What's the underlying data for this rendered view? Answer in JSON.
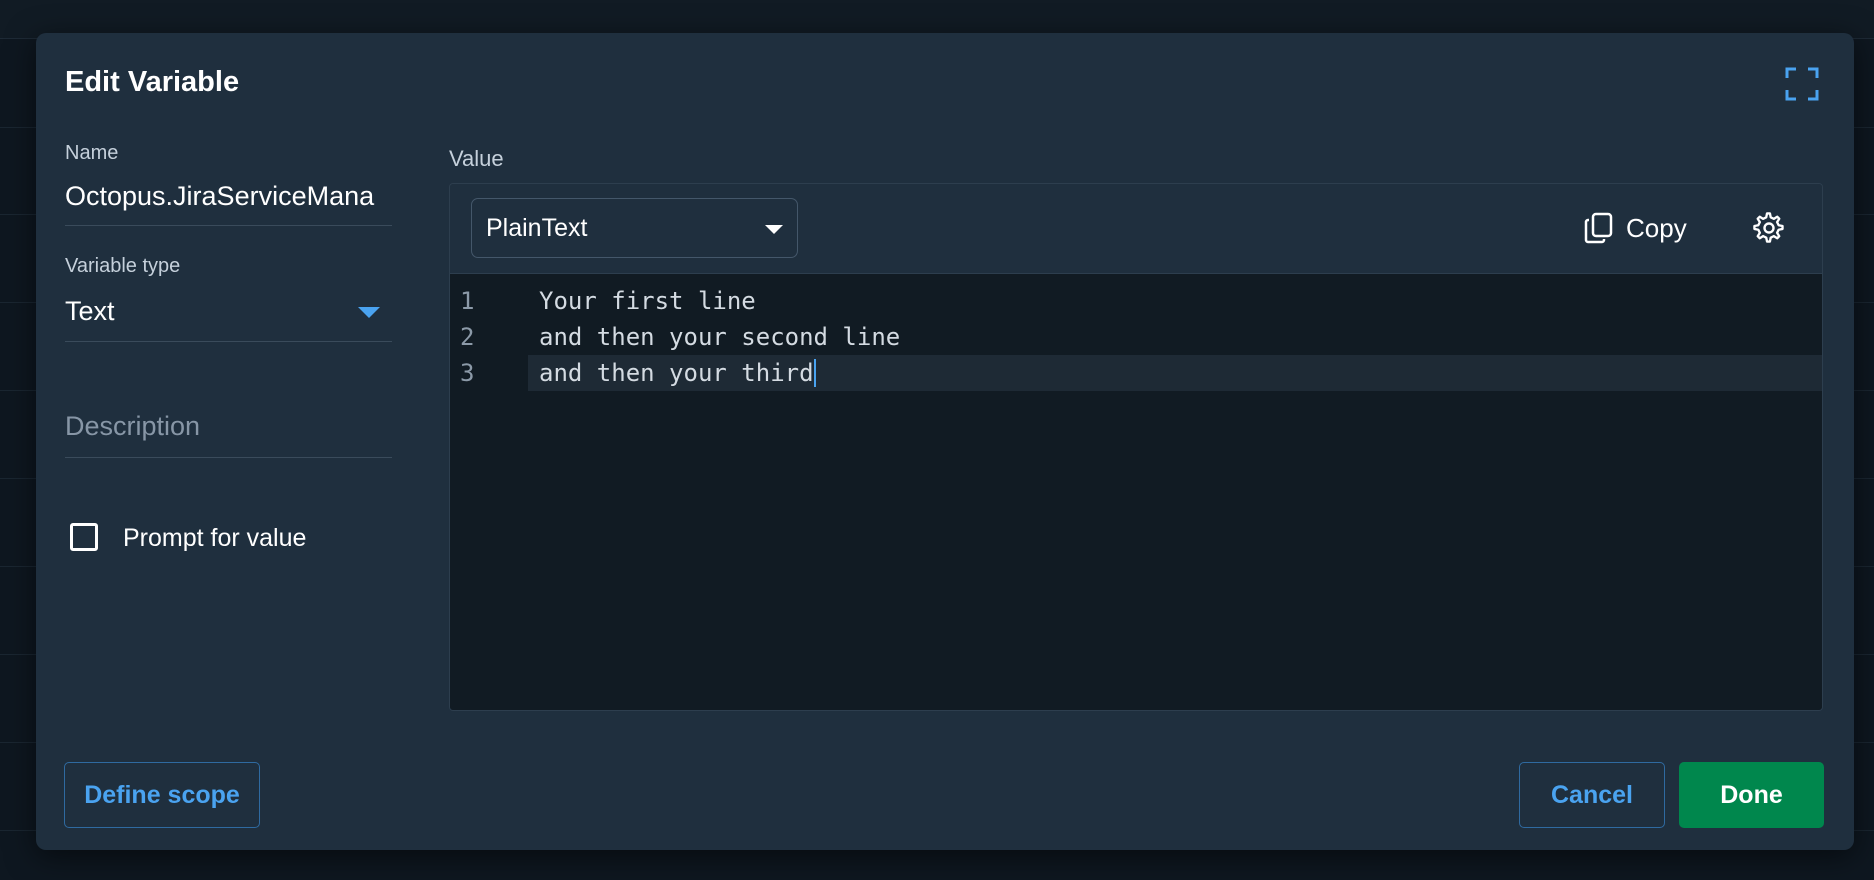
{
  "dialog": {
    "title": "Edit Variable"
  },
  "form": {
    "name_label": "Name",
    "name_value": "Octopus.JiraServiceMana",
    "type_label": "Variable type",
    "type_value": "Text",
    "description_placeholder": "Description",
    "prompt_label": "Prompt for value",
    "prompt_checked": false
  },
  "value": {
    "label": "Value",
    "syntax": "PlainText",
    "copy_label": "Copy",
    "lines": [
      {
        "number": "1",
        "text": "Your first line"
      },
      {
        "number": "2",
        "text": "and then your second line"
      },
      {
        "number": "3",
        "text": "and then your third"
      }
    ],
    "active_line": 3
  },
  "footer": {
    "define_scope_label": "Define scope",
    "cancel_label": "Cancel",
    "done_label": "Done"
  },
  "icons": {
    "fullscreen": "expand-icon",
    "copy": "copy-icon",
    "settings": "gear-icon"
  },
  "colors": {
    "accent": "#4aa3f0",
    "primary_button": "#00874d",
    "dialog_bg": "#1f2f3e",
    "editor_bg": "#111b23"
  }
}
